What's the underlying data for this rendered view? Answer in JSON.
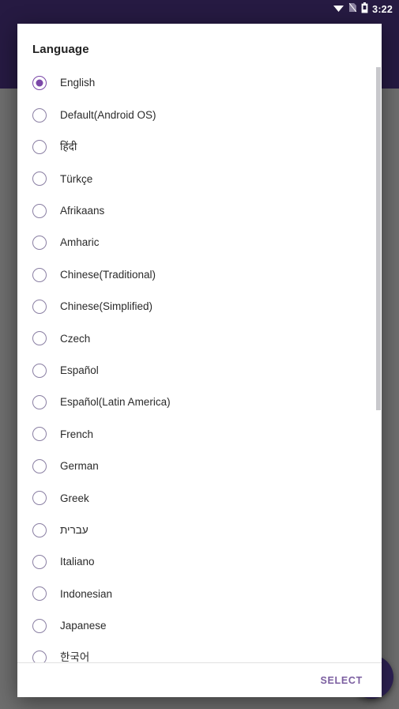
{
  "status_bar": {
    "clock": "3:22",
    "icons": [
      "wifi-icon",
      "no-sim-icon",
      "battery-icon"
    ]
  },
  "background": {
    "app_bar_color": "#261a42",
    "content_color": "#6e6e6e",
    "fab": {
      "name": "floating-action-button",
      "color": "#2e2255"
    }
  },
  "dialog": {
    "title": "Language",
    "accent_color": "#7b47a8",
    "selected_index": 0,
    "languages": [
      {
        "label": "English",
        "checked": true
      },
      {
        "label": "Default(Android OS)",
        "checked": false
      },
      {
        "label": "हिंदी",
        "checked": false
      },
      {
        "label": "Türkçe",
        "checked": false
      },
      {
        "label": "Afrikaans",
        "checked": false
      },
      {
        "label": "Amharic",
        "checked": false
      },
      {
        "label": "Chinese(Traditional)",
        "checked": false
      },
      {
        "label": "Chinese(Simplified)",
        "checked": false
      },
      {
        "label": "Czech",
        "checked": false
      },
      {
        "label": "Español",
        "checked": false
      },
      {
        "label": "Español(Latin America)",
        "checked": false
      },
      {
        "label": "French",
        "checked": false
      },
      {
        "label": "German",
        "checked": false
      },
      {
        "label": "Greek",
        "checked": false
      },
      {
        "label": "עברית",
        "checked": false
      },
      {
        "label": "Italiano",
        "checked": false
      },
      {
        "label": "Indonesian",
        "checked": false
      },
      {
        "label": "Japanese",
        "checked": false
      },
      {
        "label": "한국어",
        "checked": false
      }
    ],
    "footer": {
      "select_label": "SELECT",
      "select_color": "#7b5ea0"
    },
    "scrollbar": {
      "visible": true,
      "thumb_color": "#c8c8cc"
    }
  }
}
